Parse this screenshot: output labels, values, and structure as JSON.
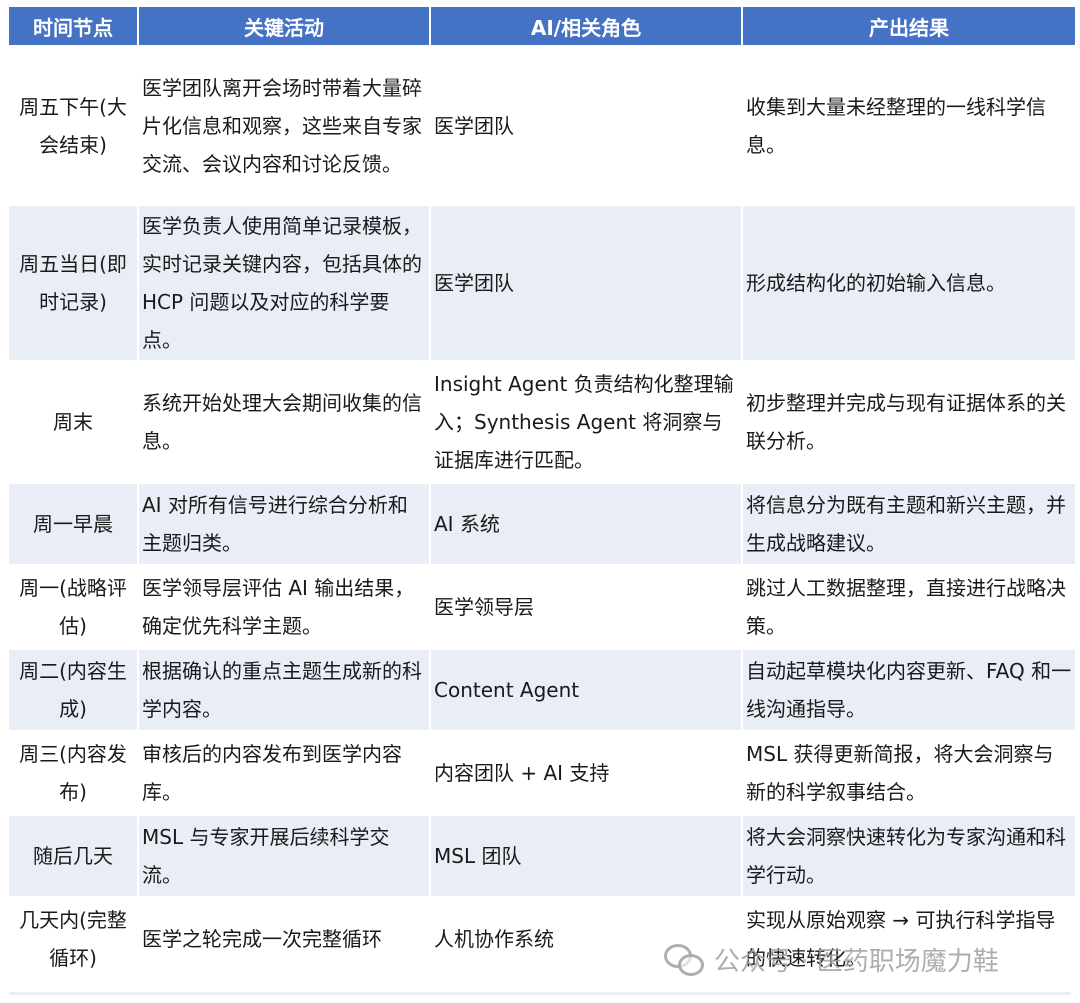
{
  "table": {
    "headers": [
      "时间节点",
      "关键活动",
      "AI/相关角色",
      "产出结果"
    ],
    "rows": [
      {
        "time": "周五下午(大会结束)",
        "activity": "医学团队离开会场时带着大量碎片化信息和观察，这些来自专家交流、会议内容和讨论反馈。",
        "role": "医学团队",
        "result": "收集到大量未经整理的一线科学信息。"
      },
      {
        "time": "周五当日(即时记录)",
        "activity": "医学负责人使用简单记录模板，实时记录关键内容，包括具体的 HCP 问题以及对应的科学要点。",
        "role": "医学团队",
        "result": "形成结构化的初始输入信息。"
      },
      {
        "time": "周末",
        "activity": "系统开始处理大会期间收集的信息。",
        "role": "Insight Agent 负责结构化整理输入；Synthesis Agent 将洞察与证据库进行匹配。",
        "result": "初步整理并完成与现有证据体系的关联分析。"
      },
      {
        "time": "周一早晨",
        "activity": "AI 对所有信号进行综合分析和主题归类。",
        "role": "AI 系统",
        "result": "将信息分为既有主题和新兴主题，并生成战略建议。"
      },
      {
        "time": "周一(战略评估)",
        "activity": "医学领导层评估 AI 输出结果，确定优先科学主题。",
        "role": "医学领导层",
        "result": "跳过人工数据整理，直接进行战略决策。"
      },
      {
        "time": "周二(内容生成)",
        "activity": "根据确认的重点主题生成新的科学内容。",
        "role": "Content Agent",
        "result": "自动起草模块化内容更新、FAQ 和一线沟通指导。"
      },
      {
        "time": "周三(内容发布)",
        "activity": "审核后的内容发布到医学内容库。",
        "role": "内容团队 + AI 支持",
        "result": "MSL 获得更新简报，将大会洞察与新的科学叙事结合。"
      },
      {
        "time": "随后几天",
        "activity": "MSL 与专家开展后续科学交流。",
        "role": "MSL 团队",
        "result": "将大会洞察快速转化为专家沟通和科学行动。"
      },
      {
        "time": "几天内(完整循环)",
        "activity": "医学之轮完成一次完整循环",
        "role": "人机协作系统",
        "result": "实现从原始观察 → 可执行科学指导的快速转化。"
      }
    ]
  },
  "watermark": {
    "icon": "wechat-icon",
    "text": "公众号 · 医药职场魔力鞋"
  },
  "colors": {
    "header_bg": "#4472c4",
    "band_bg": "#e8edf6"
  }
}
